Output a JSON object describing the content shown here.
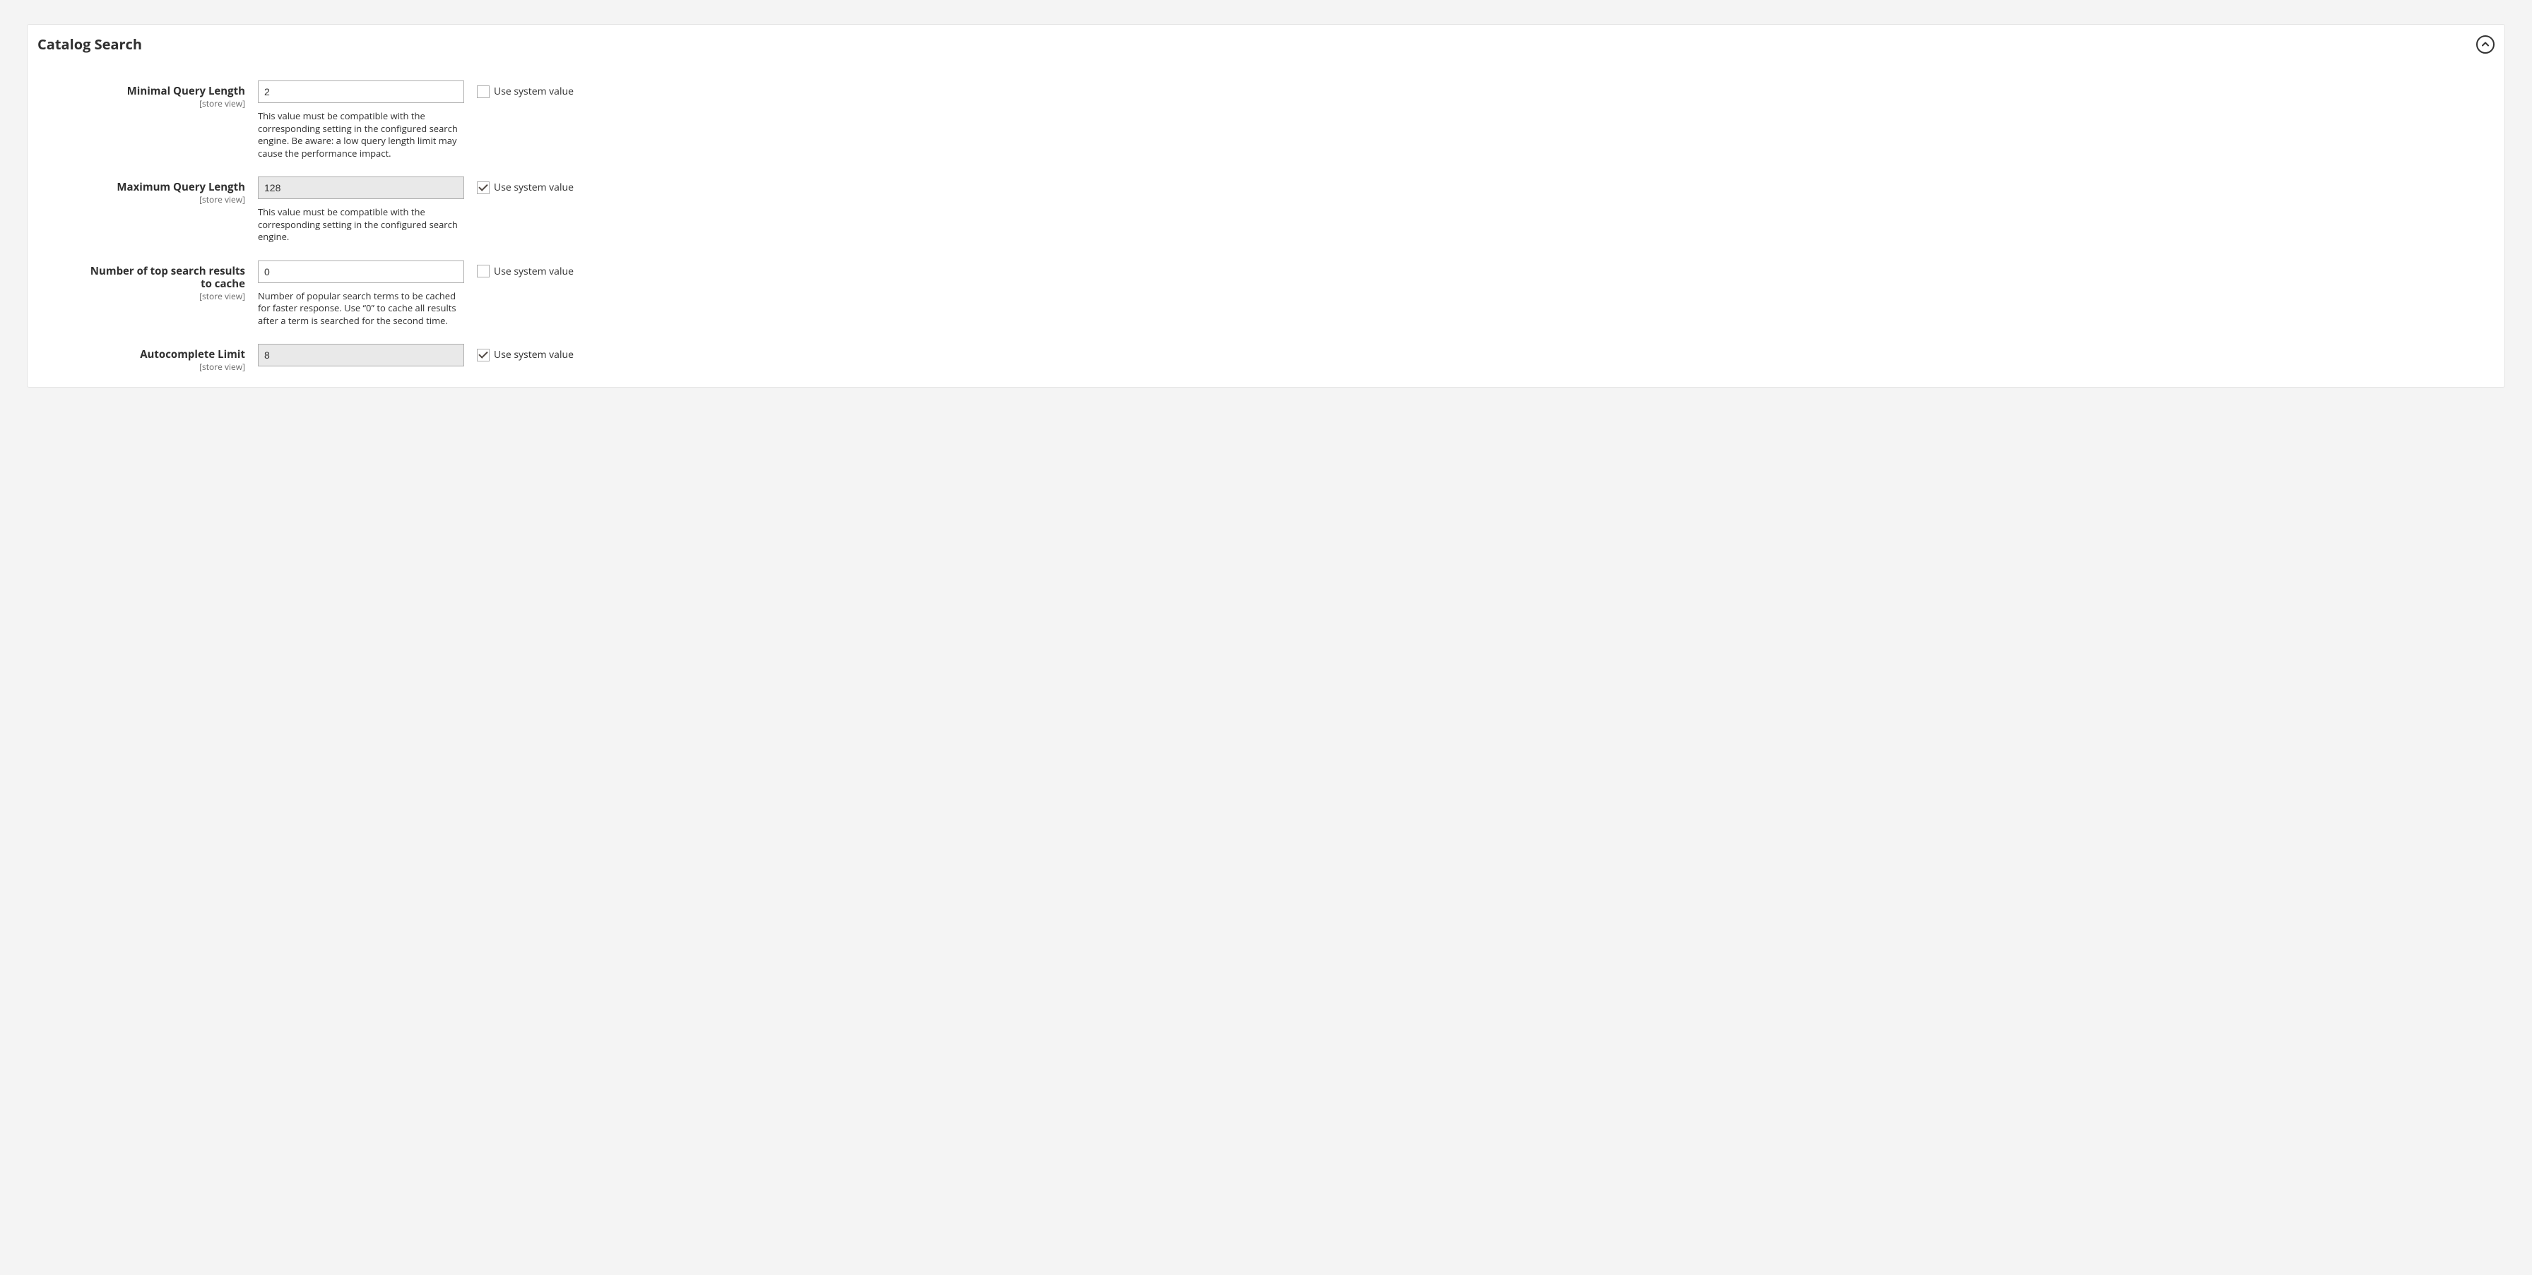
{
  "panel": {
    "title": "Catalog Search",
    "collapse_icon": "chevron-up"
  },
  "scope_text": "[store view]",
  "use_system_value_label": "Use system value",
  "fields": {
    "min_query_length": {
      "label": "Minimal Query Length",
      "value": "2",
      "disabled": false,
      "use_system": false,
      "help": "This value must be compatible with the corresponding setting in the configured search engine. Be aware: a low query length limit may cause the performance impact."
    },
    "max_query_length": {
      "label": "Maximum Query Length",
      "value": "128",
      "disabled": true,
      "use_system": true,
      "help": "This value must be compatible with the corresponding setting in the configured search engine."
    },
    "top_results_cache": {
      "label": "Number of top search results to cache",
      "value": "0",
      "disabled": false,
      "use_system": false,
      "help": "Number of popular search terms to be cached for faster response. Use “0” to cache all results after a term is searched for the second time."
    },
    "autocomplete_limit": {
      "label": "Autocomplete Limit",
      "value": "8",
      "disabled": true,
      "use_system": true,
      "help": ""
    }
  }
}
